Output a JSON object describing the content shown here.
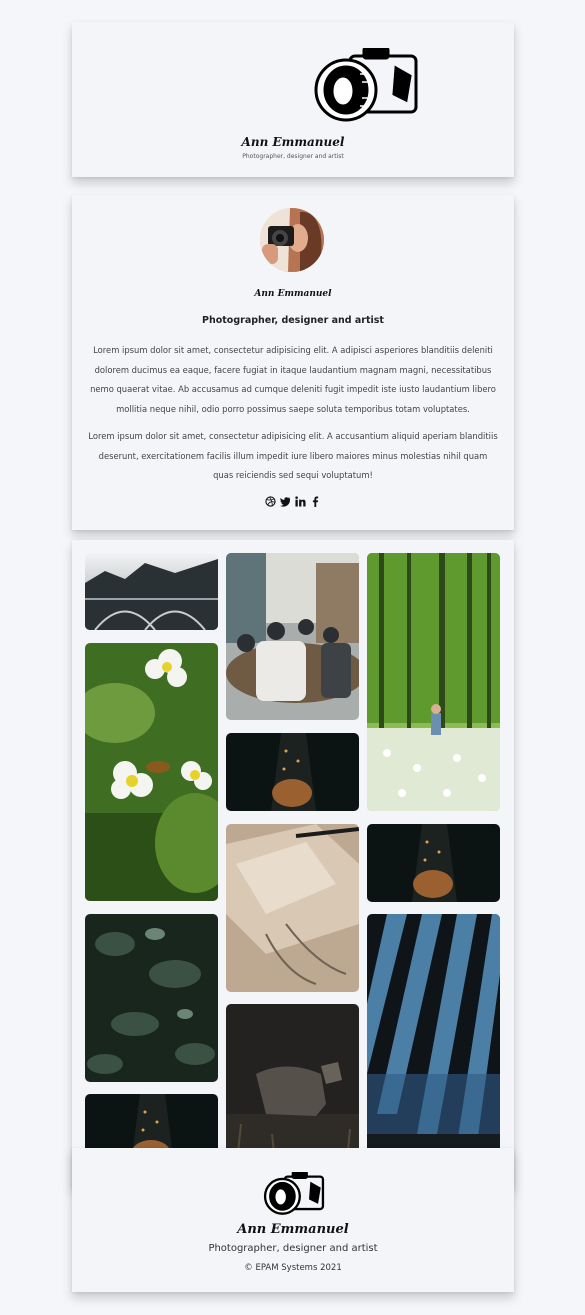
{
  "header": {
    "logo_icon": "camera-icon",
    "name": "Ann Emmanuel",
    "tagline": "Photographer, designer and artist"
  },
  "about": {
    "avatar_icon": "avatar-photo",
    "name": "Ann Emmanuel",
    "role": "Photographer, designer and artist",
    "paragraph_1": "Lorem ipsum dolor sit amet, consectetur adipisicing elit. A adipisci asperiores blanditiis deleniti dolorem ducimus ea eaque, facere fugiat in itaque laudantium magnam magni, necessitatibus nemo quaerat vitae. Ab accusamus ad cumque deleniti fugit impedit iste iusto laudantium libero mollitia neque nihil, odio porro possimus saepe soluta temporibus totam voluptates.",
    "paragraph_2": "Lorem ipsum dolor sit amet, consectetur adipisicing elit. A accusantium aliquid aperiam blanditiis deserunt, exercitationem facilis illum impedit iure libero maiores minus molestias nihil quam quas reiciendis sed sequi voluptatum!",
    "socials": [
      {
        "name": "dribbble-icon"
      },
      {
        "name": "twitter-icon"
      },
      {
        "name": "linkedin-icon"
      },
      {
        "name": "facebook-icon"
      }
    ]
  },
  "gallery": {
    "photos": [
      {
        "name": "photo-bridge",
        "subject": "bridge over forest",
        "colors": [
          "#e8eaec",
          "#3a3f42",
          "#1e2427"
        ]
      },
      {
        "name": "photo-bee-flowers",
        "subject": "bee on strawberry flowers",
        "colors": [
          "#5a8a2c",
          "#2e5418",
          "#93b35a"
        ]
      },
      {
        "name": "photo-leaves",
        "subject": "dark leaves",
        "colors": [
          "#1b2a22",
          "#3e5547",
          "#0f1914"
        ]
      },
      {
        "name": "photo-alley-1",
        "subject": "night alley",
        "colors": [
          "#0c1414",
          "#2a2f2c",
          "#b06a34"
        ]
      },
      {
        "name": "photo-meeting",
        "subject": "people at office table",
        "colors": [
          "#6e7678",
          "#d9d9d6",
          "#3b3f40"
        ]
      },
      {
        "name": "photo-alley-2",
        "subject": "night alley",
        "colors": [
          "#0c1414",
          "#2a2f2c",
          "#b06a34"
        ]
      },
      {
        "name": "photo-paper-pen",
        "subject": "paper and pen on desk",
        "colors": [
          "#c6b39c",
          "#a08a72",
          "#e3d6c4"
        ]
      },
      {
        "name": "photo-wolf",
        "subject": "wolf in dark forest",
        "colors": [
          "#2b2a28",
          "#4a4640",
          "#1a1917"
        ]
      },
      {
        "name": "photo-forest-child",
        "subject": "child in green forest",
        "colors": [
          "#6aa53a",
          "#c3dc8e",
          "#e7efe0"
        ]
      },
      {
        "name": "photo-alley-3",
        "subject": "night alley",
        "colors": [
          "#0c1414",
          "#2a2f2c",
          "#b06a34"
        ]
      },
      {
        "name": "photo-blue-shadows",
        "subject": "blue wall with shadows",
        "colors": [
          "#1f2a33",
          "#4a7ea5",
          "#0e1318"
        ]
      }
    ]
  },
  "footer": {
    "logo_icon": "camera-icon",
    "name": "Ann Emmanuel",
    "tagline": "Photographer, designer and artist",
    "copyright": "© EPAM Systems 2021"
  }
}
